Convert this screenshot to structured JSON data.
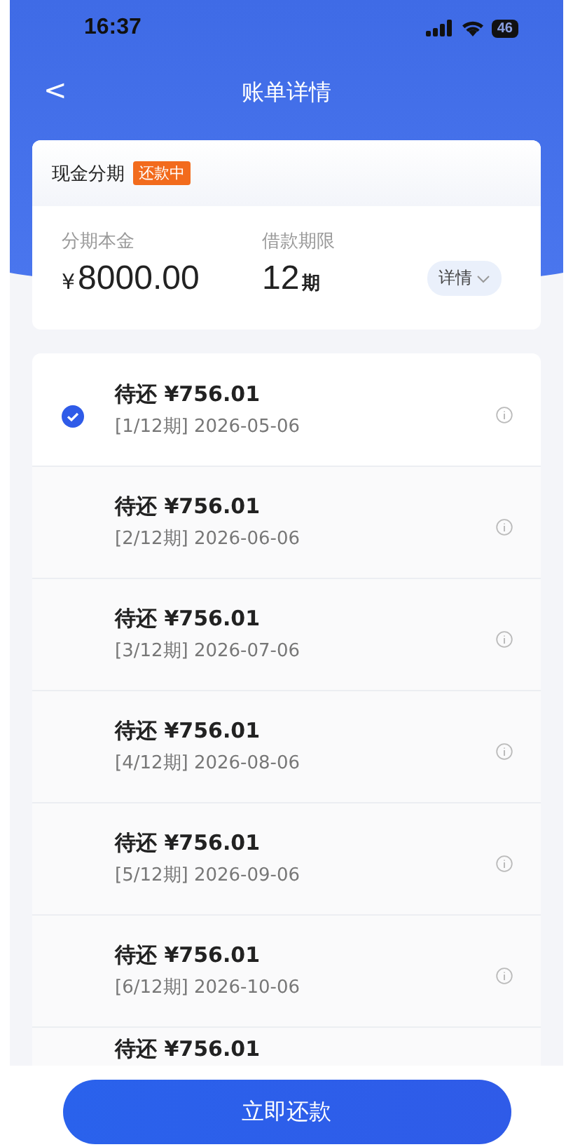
{
  "status_bar": {
    "time": "16:37",
    "battery": "46"
  },
  "nav": {
    "back": "<",
    "title": "账单详情"
  },
  "summary": {
    "title": "现金分期",
    "status_badge": "还款中",
    "principal_label": "分期本金",
    "principal_currency": "¥",
    "principal": "8000.00",
    "term_label": "借款期限",
    "term": "12",
    "term_unit": "期",
    "details_button": "详情"
  },
  "installments": [
    {
      "amount": "待还 ¥756.01",
      "period": "[1/12期] 2026-05-06",
      "selected": true
    },
    {
      "amount": "待还 ¥756.01",
      "period": "[2/12期] 2026-06-06",
      "selected": false
    },
    {
      "amount": "待还 ¥756.01",
      "period": "[3/12期] 2026-07-06",
      "selected": false
    },
    {
      "amount": "待还 ¥756.01",
      "period": "[4/12期] 2026-08-06",
      "selected": false
    },
    {
      "amount": "待还 ¥756.01",
      "period": "[5/12期] 2026-09-06",
      "selected": false
    },
    {
      "amount": "待还 ¥756.01",
      "period": "[6/12期] 2026-10-06",
      "selected": false
    },
    {
      "amount": "待还 ¥756.01",
      "selected": false
    }
  ],
  "pay_button": "立即还款"
}
